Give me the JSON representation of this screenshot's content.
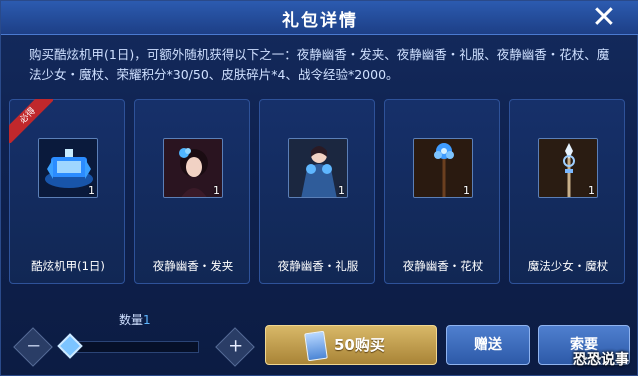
{
  "dialog": {
    "title": "礼包详情",
    "close_symbol": "✕",
    "description": "购买酷炫机甲(1日)，可额外随机获得以下之一：夜静幽香・发夹、夜静幽香・礼服、夜静幽香・花杖、魔法少女・魔杖、荣耀积分*30/50、皮肤碎片*4、战令经验*2000。"
  },
  "items": [
    {
      "name": "酷炫机甲(1日)",
      "qty": "1",
      "ribbon": "必得",
      "icon": "mech-icon"
    },
    {
      "name": "夜静幽香・发夹",
      "qty": "1",
      "icon": "hairpin-avatar-icon"
    },
    {
      "name": "夜静幽香・礼服",
      "qty": "1",
      "icon": "gown-avatar-icon"
    },
    {
      "name": "夜静幽香・花杖",
      "qty": "1",
      "icon": "flower-staff-icon"
    },
    {
      "name": "魔法少女・魔杖",
      "qty": "1",
      "icon": "magic-wand-icon"
    }
  ],
  "controls": {
    "quantity_label": "数量",
    "quantity_value": "1",
    "minus": "−",
    "plus": "+",
    "buy_label": "50购买",
    "gift_label": "赠送",
    "ask_label": "索要"
  },
  "watermark": "恐恐说事",
  "colors": {
    "accent_blue": "#5fb7ff",
    "gold_button": "#c9a350",
    "ribbon_red": "#c0282c"
  }
}
